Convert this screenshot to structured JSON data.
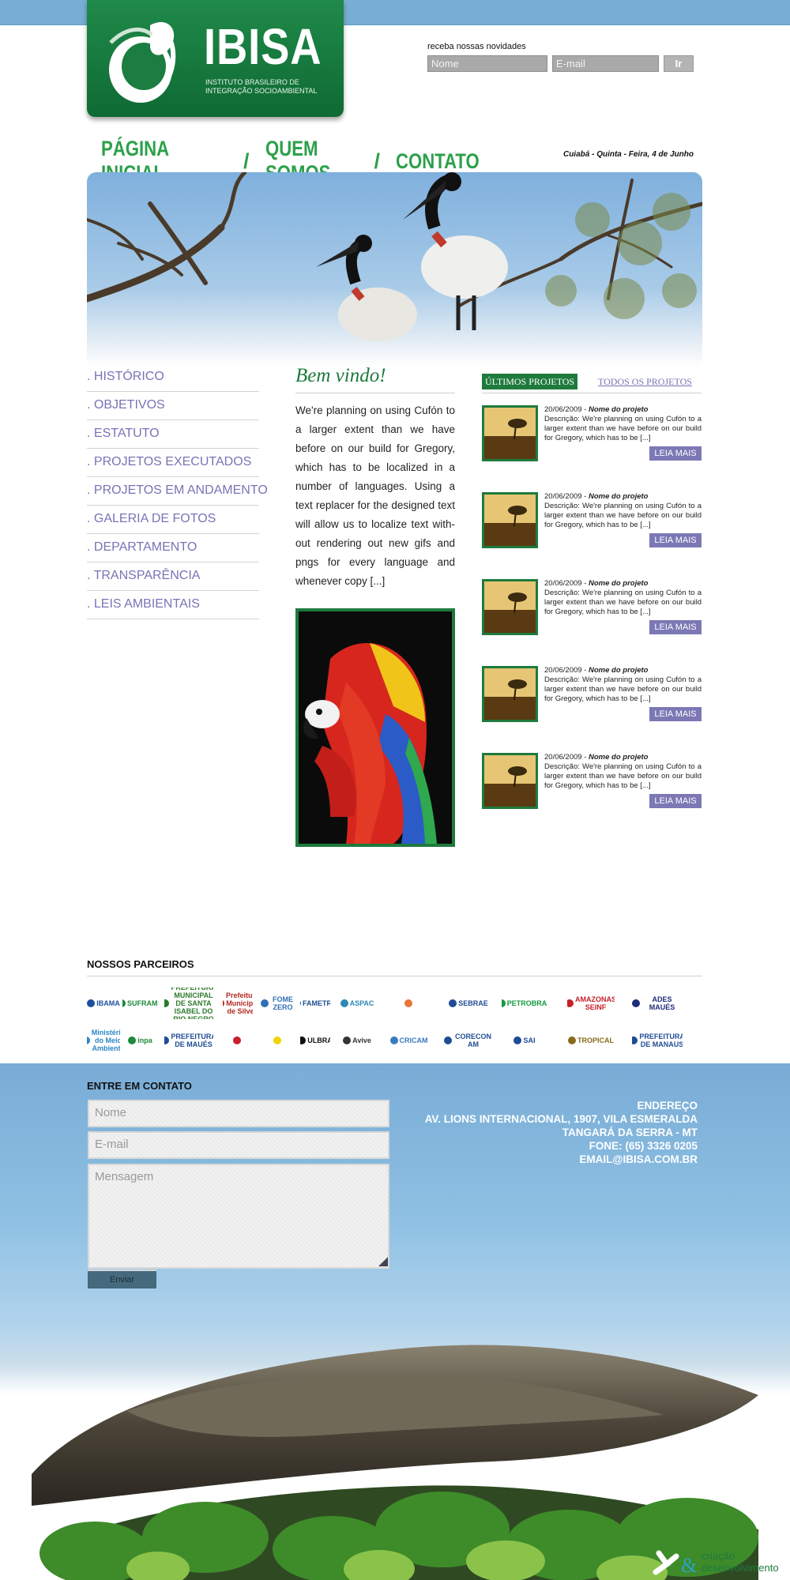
{
  "header": {
    "brand": "IBISA",
    "brand_subtitle": "INSTITUTO BRASILEIRO DE INTEGRAÇÃO SOCIOAMBIENTAL",
    "newsletter": {
      "label": "receba nossas novidades",
      "name_placeholder": "Nome",
      "email_placeholder": "E-mail",
      "submit_label": "Ir"
    }
  },
  "nav": {
    "home": "PÁGINA INICIAL",
    "about": "QUEM SOMOS",
    "contact": "CONTATO",
    "separator": "/"
  },
  "date_text": "Cuiabá - Quinta - Feira, 4 de Junho",
  "sidebar": {
    "items": [
      {
        "label": ". HISTÓRICO"
      },
      {
        "label": ". OBJETIVOS"
      },
      {
        "label": ". ESTATUTO"
      },
      {
        "label": ". PROJETOS EXECUTADOS"
      },
      {
        "label": ". PROJETOS EM ANDAMENTO"
      },
      {
        "label": ". GALERIA DE FOTOS"
      },
      {
        "label": ". DEPARTAMENTO"
      },
      {
        "label": ". TRANSPARÊNCIA"
      },
      {
        "label": ". LEIS AMBIENTAIS"
      }
    ]
  },
  "welcome": {
    "title": "Bem vindo!",
    "text": "We're planning on using Cufón to a larger extent than we have before on our build for Gregory, which has to be localized in a number of languages.  Using a text replacer for the designed text will allow us to localize text with-out rendering out new gifs and pngs for every language and whenever copy [...]"
  },
  "projects": {
    "latest_label": "ÚLTIMOS PROJETOS",
    "all_label": "TODOS OS PROJETOS",
    "items": [
      {
        "date": "20/06/2009 - ",
        "name": "Nome do projeto",
        "description": "Descrição: We're planning on using Cufón to a larger extent than we have before on our build for Gregory, which has to be [...]",
        "button": "LEIA MAIS"
      },
      {
        "date": "20/06/2009 - ",
        "name": "Nome do projeto",
        "description": "Descrição: We're planning on using Cufón to a larger extent than we have before on our build for Gregory, which has to be [...]",
        "button": "LEIA MAIS"
      },
      {
        "date": "20/06/2009 - ",
        "name": "Nome do projeto",
        "description": "Descrição: We're planning on using Cufón to a larger extent than we have before on our build for Gregory, which has to be [...]",
        "button": "LEIA MAIS"
      },
      {
        "date": "20/06/2009 - ",
        "name": "Nome do projeto",
        "description": "Descrição: We're planning on using Cufón to a larger extent than we have before on our build for Gregory, which has to be [...]",
        "button": "LEIA MAIS"
      },
      {
        "date": "20/06/2009 - ",
        "name": "Nome do projeto",
        "description": "Descrição: We're planning on using Cufón to a larger extent than we have before on our build for Gregory, which has to be [...]",
        "button": "LEIA MAIS"
      }
    ]
  },
  "partners": {
    "title": "NOSSOS PARCEIROS",
    "row1": [
      {
        "label": "IBAMA",
        "icon": "ibama-logo",
        "color": "#1c4f9c"
      },
      {
        "label": "SUFRAMA",
        "icon": "suframa-logo",
        "color": "#1d8a3a"
      },
      {
        "label": "PREFEITURA MUNICIPAL DE SANTA ISABEL DO RIO NEGRO",
        "icon": "prefeitura-santa-isabel-logo",
        "color": "#2d7a2d"
      },
      {
        "label": "Prefeitura Municipal de Silves",
        "icon": "silves-logo",
        "color": "#b3261e"
      },
      {
        "label": "FOME ZERO",
        "icon": "fome-zero-logo",
        "color": "#2f6fb5"
      },
      {
        "label": "FAMETRO",
        "icon": "fametro-logo",
        "color": "#1e4f8e"
      },
      {
        "label": "ASPAC",
        "icon": "aspac-logo",
        "color": "#2d8ab5"
      },
      {
        "label": "",
        "icon": "orange-x-logo",
        "color": "#e8743b"
      },
      {
        "label": "SEBRAE",
        "icon": "sebrae-logo",
        "color": "#1f4c94"
      },
      {
        "label": "PETROBRAS",
        "icon": "petrobras-logo",
        "color": "#149a3d"
      },
      {
        "label": "AMAZONAS SEINF",
        "icon": "amazonas-seinf-logo",
        "color": "#c8202b"
      },
      {
        "label": "ADES MAUÉS",
        "icon": "ades-maues-logo",
        "color": "#1f2b7a"
      }
    ],
    "row2": [
      {
        "label": "Ministério do Meio Ambiente",
        "icon": "mma-logo",
        "color": "#2a86c8"
      },
      {
        "label": "inpa",
        "icon": "inpa-logo",
        "color": "#1d8a3a"
      },
      {
        "label": "PREFEITURA DE MAUÉS",
        "icon": "prefeitura-maues-logo",
        "color": "#1f4c94"
      },
      {
        "label": "",
        "icon": "seal-logo",
        "color": "#c8202b"
      },
      {
        "label": "",
        "icon": "banco-do-brasil-logo",
        "color": "#f0d400"
      },
      {
        "label": "ULBRA",
        "icon": "ulbra-logo",
        "color": "#111111"
      },
      {
        "label": "Avive",
        "icon": "avive-logo",
        "color": "#333333"
      },
      {
        "label": "CRICAM",
        "icon": "cricam-logo",
        "color": "#3a7bbf"
      },
      {
        "label": "CORECON AM",
        "icon": "corecon-logo",
        "color": "#1f4c94"
      },
      {
        "label": "SAI",
        "icon": "sai-logo",
        "color": "#1f4c94"
      },
      {
        "label": "TROPICAL",
        "icon": "tropical-logo",
        "color": "#8a6a1f"
      },
      {
        "label": "PREFEITURA DE MANAUS",
        "icon": "prefeitura-manaus-logo",
        "color": "#1f4c94"
      }
    ]
  },
  "contact": {
    "title": "ENTRE EM CONTATO",
    "name_placeholder": "Nome",
    "email_placeholder": "E-mail",
    "message_placeholder": "Mensagem",
    "send_label": "Enviar",
    "address_lines": [
      "ENDEREÇO",
      "AV. LIONS INTERNACIONAL, 1907, VILA ESMERALDA",
      "TANGARÁ DA SERRA - MT",
      "FONE: (65) 3326 0205",
      "EMAIL@IBISA.COM.BR"
    ]
  },
  "credit": {
    "line1": "criação",
    "line2": "desenvolvimento"
  },
  "colors": {
    "brand_green": "#1e7a3d",
    "nav_green": "#2ca04a",
    "menu_purple": "#7774b6",
    "button_purple": "#7c78b5",
    "sky_blue": "#78aed3"
  }
}
